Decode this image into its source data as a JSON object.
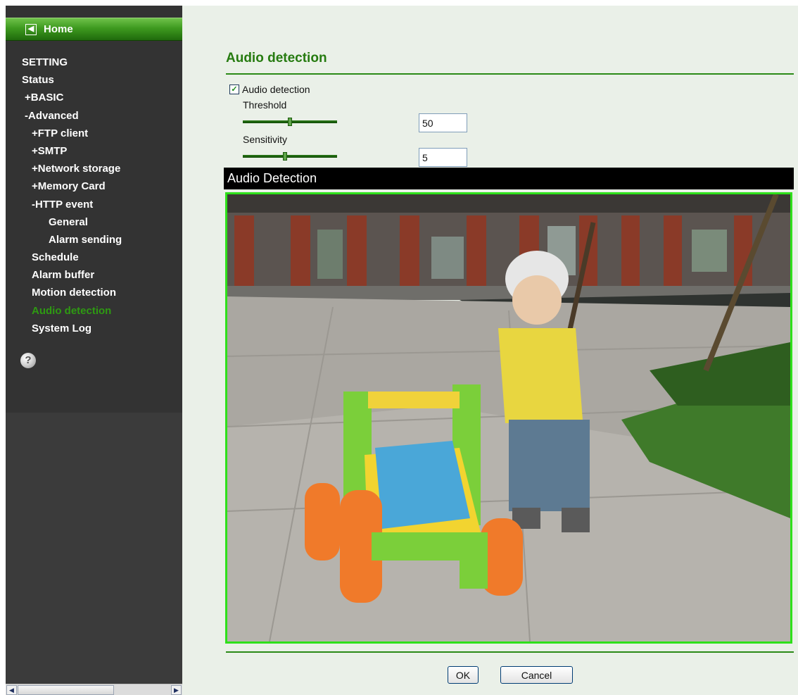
{
  "sidebar": {
    "home_label": "Home",
    "nav": [
      {
        "label": "SETTING",
        "level": 0,
        "active": false
      },
      {
        "label": "Status",
        "level": 0,
        "active": false
      },
      {
        "label": "+BASIC",
        "level": 1,
        "active": false
      },
      {
        "label": "-Advanced",
        "level": 1,
        "active": false
      },
      {
        "label": "+FTP client",
        "level": 2,
        "active": false
      },
      {
        "label": "+SMTP",
        "level": 2,
        "active": false
      },
      {
        "label": "+Network storage",
        "level": 2,
        "active": false
      },
      {
        "label": "+Memory Card",
        "level": 2,
        "active": false
      },
      {
        "label": "-HTTP event",
        "level": 2,
        "active": false
      },
      {
        "label": "General",
        "level": 3,
        "active": false
      },
      {
        "label": "Alarm sending",
        "level": 3,
        "active": false
      },
      {
        "label": "Schedule",
        "level": 2,
        "active": false
      },
      {
        "label": "Alarm buffer",
        "level": 2,
        "active": false
      },
      {
        "label": "Motion detection",
        "level": 2,
        "active": false
      },
      {
        "label": "Audio detection",
        "level": 2,
        "active": true
      },
      {
        "label": "System Log",
        "level": 2,
        "active": false
      }
    ],
    "help_glyph": "?",
    "icons": {
      "home": "back-arrow-icon",
      "help": "question-mark-icon"
    }
  },
  "main": {
    "title": "Audio detection",
    "checkbox": {
      "label": "Audio detection",
      "checked": true
    },
    "threshold": {
      "label": "Threshold",
      "value": "50",
      "slider_fraction": 0.5
    },
    "sensitivity": {
      "label": "Sensitivity",
      "value": "5",
      "slider_fraction": 0.45
    },
    "panel": {
      "title": "Audio Detection"
    },
    "buttons": {
      "ok": "OK",
      "cancel": "Cancel"
    }
  },
  "colors": {
    "accent": "#267b10",
    "active_nav": "#2e9a12",
    "sidebar_bg": "#333333",
    "detection_frame": "#2ee01a",
    "content_bg": "#eaf0e8"
  }
}
